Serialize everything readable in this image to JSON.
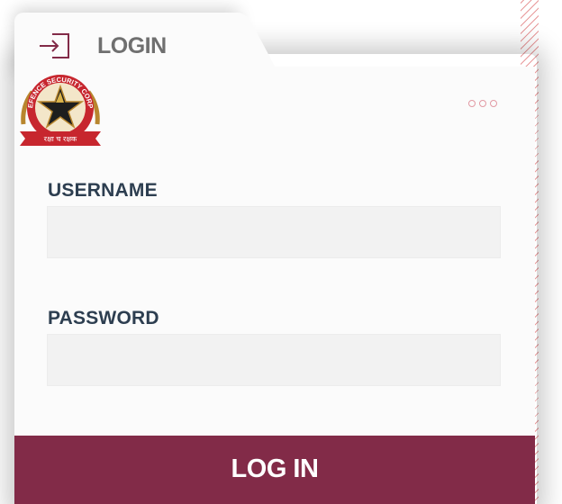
{
  "tab": {
    "label": "LOGIN",
    "icon": "sign-in-icon"
  },
  "logo": {
    "icon": "emblem-logo",
    "top_text": "DEFENCE SECURITY CORPS",
    "ribbon_text": "रक्षा च रक्षक"
  },
  "menu": {
    "icon": "more-dots-icon"
  },
  "form": {
    "username_label": "USERNAME",
    "username_value": "",
    "password_label": "PASSWORD",
    "password_value": "",
    "submit_label": "LOG IN"
  },
  "colors": {
    "accent": "#822b48",
    "label": "#2d3e50",
    "tab_text": "#6f6f6f",
    "dots": "#e29aa4"
  }
}
